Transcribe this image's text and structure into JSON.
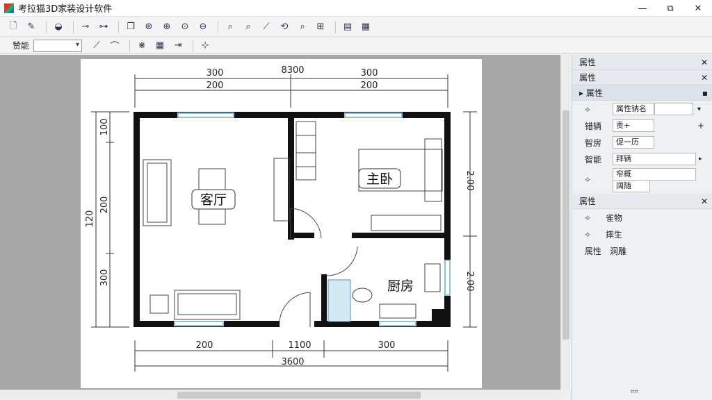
{
  "window": {
    "title": "考拉猫3D家装设计软件",
    "controls": {
      "minimize": "—",
      "maximize": "⧉",
      "close": "✕"
    }
  },
  "toolbar2": {
    "label": "赞能"
  },
  "floorplan": {
    "dims_top_outer": [
      "300",
      "8300",
      "300"
    ],
    "dims_top_inner": [
      "200",
      "200"
    ],
    "dims_bottom_inner": [
      "200",
      "1100",
      "300"
    ],
    "dims_bottom_outer": "3600",
    "dims_left_outer": "120",
    "dims_left_inner": [
      "100",
      "200",
      "300"
    ],
    "dims_right": [
      "2.00",
      "2.00"
    ],
    "rooms": {
      "living": "客厅",
      "master": "主卧",
      "kitchen": "厨房"
    }
  },
  "panel": {
    "header1": "属性",
    "header2": "属性",
    "section1": "属性",
    "row1_field": "属性钠名",
    "row2_label": "错辆",
    "row2_field": "责+",
    "row3_label": "智房",
    "row3_field": "促一历",
    "row4_label": "智能",
    "row4_field": "拜辆",
    "row5_field1": "窄概",
    "row5_field2": "阔随",
    "section2": "属性",
    "list": [
      {
        "icon": "tool-icon",
        "label": "雀物"
      },
      {
        "icon": "tool-icon",
        "label": "摔生"
      },
      {
        "icon": "",
        "label": "洞雕",
        "prefix": "属性"
      }
    ],
    "close_glyph": "✕",
    "bottom_mark": "⌗⌗"
  },
  "colors": {
    "wall": "#111111",
    "window": "#8fc3dc",
    "canvas": "#a7a7a7"
  }
}
